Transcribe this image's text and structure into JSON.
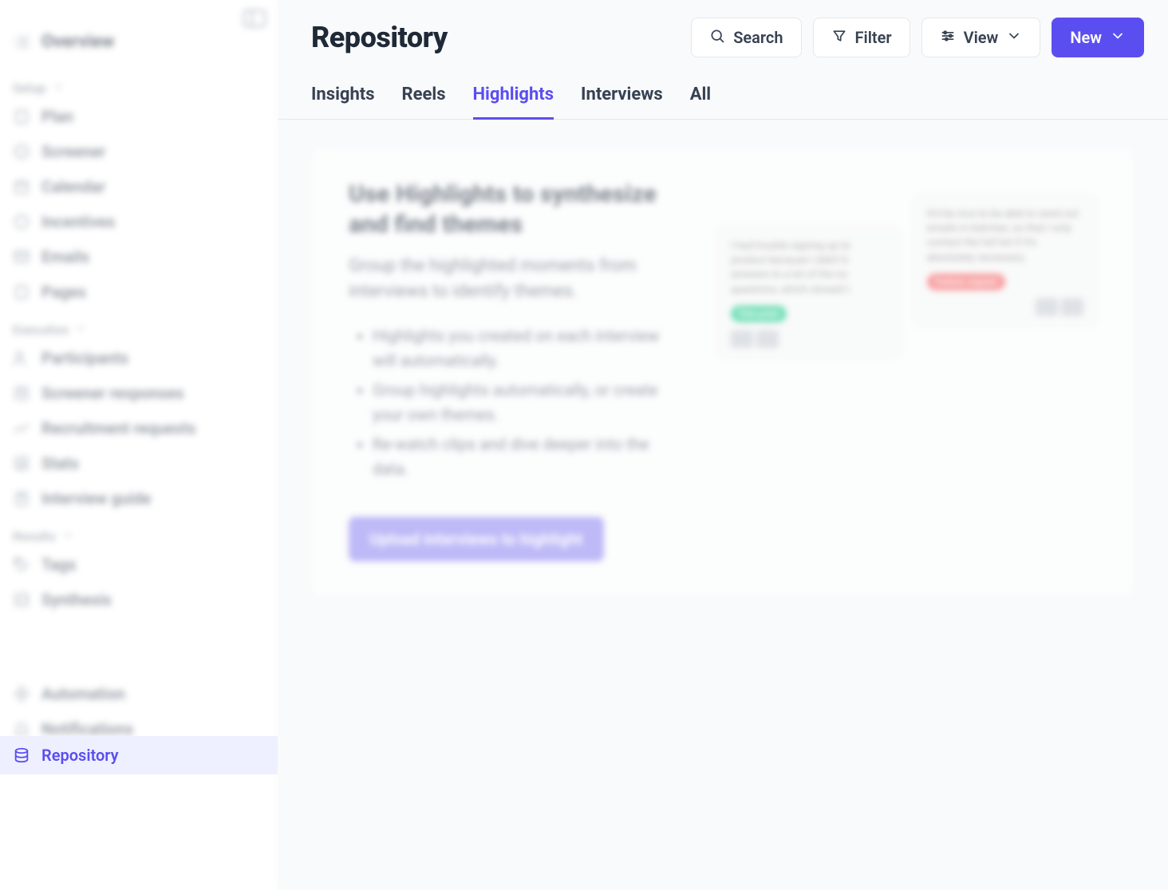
{
  "page": {
    "title": "Repository"
  },
  "header": {
    "search_label": "Search",
    "filter_label": "Filter",
    "view_label": "View",
    "new_label": "New"
  },
  "tabs": [
    {
      "label": "Insights",
      "id": "insights"
    },
    {
      "label": "Reels",
      "id": "reels"
    },
    {
      "label": "Highlights",
      "id": "highlights",
      "active": true
    },
    {
      "label": "Interviews",
      "id": "interviews"
    },
    {
      "label": "All",
      "id": "all"
    }
  ],
  "sidebar": {
    "overview_label": "Overview",
    "groups": {
      "setup": {
        "label": "Setup",
        "items": [
          {
            "label": "Plan"
          },
          {
            "label": "Screener"
          },
          {
            "label": "Calendar"
          },
          {
            "label": "Incentives"
          },
          {
            "label": "Emails"
          },
          {
            "label": "Pages"
          }
        ]
      },
      "execution": {
        "label": "Execution",
        "items": [
          {
            "label": "Participants"
          },
          {
            "label": "Screener responses"
          },
          {
            "label": "Recruitment requests"
          },
          {
            "label": "Stats"
          },
          {
            "label": "Interview guide"
          }
        ]
      },
      "results": {
        "label": "Results",
        "items": [
          {
            "label": "Tags"
          },
          {
            "label": "Synthesis"
          },
          {
            "label": "Repository",
            "active": true
          }
        ]
      },
      "extra": {
        "items": [
          {
            "label": "Automation"
          },
          {
            "label": "Notifications"
          }
        ]
      }
    }
  },
  "empty_state": {
    "title": "Use Highlights to synthesize and find themes",
    "subtitle": "Group the highlighted moments from interviews to identify themes.",
    "bullets": [
      "Highlights you created on each interview will automatically.",
      "Group highlights automatically, or create your own themes.",
      "Re-watch clips and dive deeper into the data."
    ],
    "cta_label": "Upload interviews to highlight",
    "examples": {
      "left_note": "I had trouble signing up to product because I didn't k answers to a lot of the no questions, which slowed t",
      "left_pill": "Pain point",
      "right_note": "It'd be nice to be able to send out emails in batches, so that I only contact the full list if it's absolutely necessary.",
      "right_pill": "Feature request"
    }
  }
}
